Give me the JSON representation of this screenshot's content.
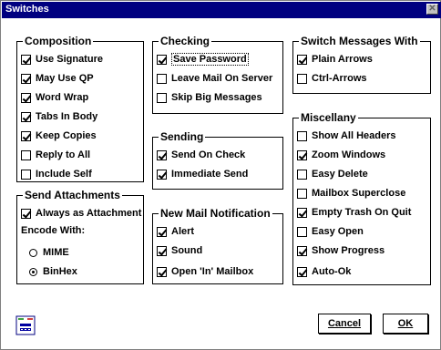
{
  "window": {
    "title": "Switches",
    "close_glyph": "✕"
  },
  "composition": {
    "title": "Composition",
    "items": [
      {
        "label": "Use Signature",
        "checked": true
      },
      {
        "label": "May Use QP",
        "checked": true
      },
      {
        "label": "Word Wrap",
        "checked": true
      },
      {
        "label": "Tabs In Body",
        "checked": true
      },
      {
        "label": "Keep Copies",
        "checked": true
      },
      {
        "label": "Reply to All",
        "checked": false
      },
      {
        "label": "Include Self",
        "checked": false
      }
    ]
  },
  "send_attachments": {
    "title": "Send Attachments",
    "always_label": "Always as Attachment",
    "always_checked": true,
    "encode_label": "Encode With:",
    "options": [
      {
        "label": "MIME",
        "selected": false
      },
      {
        "label": "BinHex",
        "selected": true
      }
    ]
  },
  "checking": {
    "title": "Checking",
    "items": [
      {
        "label": "Save Password",
        "checked": true
      },
      {
        "label": "Leave Mail On Server",
        "checked": false
      },
      {
        "label": "Skip Big Messages",
        "checked": false
      }
    ]
  },
  "sending": {
    "title": "Sending",
    "items": [
      {
        "label": "Send On Check",
        "checked": true
      },
      {
        "label": "Immediate Send",
        "checked": true
      }
    ]
  },
  "new_mail": {
    "title": "New Mail Notification",
    "items": [
      {
        "label": "Alert",
        "checked": true
      },
      {
        "label": "Sound",
        "checked": true
      },
      {
        "label": "Open 'In' Mailbox",
        "checked": true
      }
    ]
  },
  "switch_messages": {
    "title": "Switch Messages With",
    "items": [
      {
        "label": "Plain Arrows",
        "checked": true
      },
      {
        "label": "Ctrl-Arrows",
        "checked": false
      }
    ]
  },
  "miscellany": {
    "title": "Miscellany",
    "items": [
      {
        "label": "Show All Headers",
        "checked": false
      },
      {
        "label": "Zoom Windows",
        "checked": true
      },
      {
        "label": "Easy Delete",
        "checked": false
      },
      {
        "label": "Mailbox Superclose",
        "checked": false
      },
      {
        "label": "Empty Trash On Quit",
        "checked": true
      },
      {
        "label": "Easy Open",
        "checked": false
      },
      {
        "label": "Show Progress",
        "checked": true
      },
      {
        "label": "Auto-Ok",
        "checked": true
      }
    ]
  },
  "buttons": {
    "cancel_label": "Cancel",
    "ok_label": "OK"
  },
  "icons": {
    "app": "app-document-icon"
  }
}
